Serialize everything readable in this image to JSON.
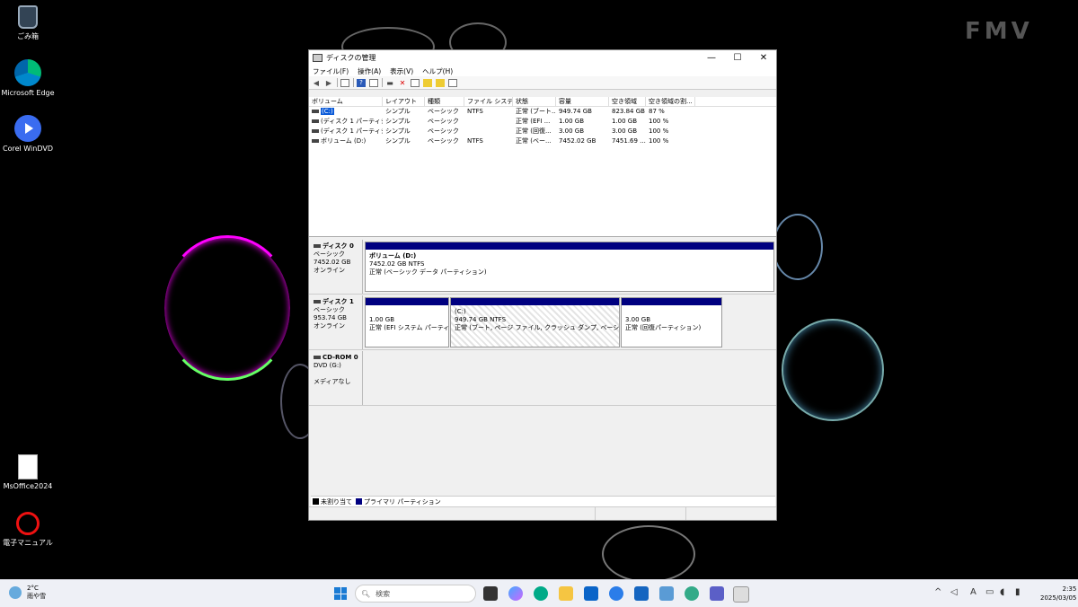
{
  "desktop": {
    "brand": "FMV",
    "icons": [
      {
        "label": "ごみ箱",
        "icon": "recycle-bin-icon"
      },
      {
        "label": "Microsoft Edge",
        "icon": "edge-icon"
      },
      {
        "label": "Corel WinDVD",
        "icon": "windvd-icon"
      },
      {
        "label": "MsOffice2024",
        "icon": "document-icon"
      },
      {
        "label": "電子マニュアル",
        "icon": "manual-icon"
      }
    ]
  },
  "window": {
    "title": "ディスクの管理",
    "controls": {
      "minimize": "—",
      "maximize": "☐",
      "close": "✕"
    },
    "menu": [
      "ファイル(F)",
      "操作(A)",
      "表示(V)",
      "ヘルプ(H)"
    ],
    "toolbar": [
      "back-icon",
      "forward-icon",
      "properties-icon",
      "help-icon",
      "view-icon",
      "connect-icon",
      "delete-icon",
      "check-icon",
      "new-icon",
      "open-icon",
      "list-icon"
    ],
    "volume_list": {
      "columns": [
        "ボリューム",
        "レイアウト",
        "種類",
        "ファイル システム",
        "状態",
        "容量",
        "空き領域",
        "空き領域の割..."
      ],
      "rows": [
        [
          "(C:)",
          "シンプル",
          "ベーシック",
          "NTFS",
          "正常 (ブート...",
          "949.74 GB",
          "823.84 GB",
          "87 %"
        ],
        [
          "(ディスク 1 パーティシ...",
          "シンプル",
          "ベーシック",
          "",
          "正常 (EFI ...",
          "1.00 GB",
          "1.00 GB",
          "100 %"
        ],
        [
          "(ディスク 1 パーティシ...",
          "シンプル",
          "ベーシック",
          "",
          "正常 (回復...",
          "3.00 GB",
          "3.00 GB",
          "100 %"
        ],
        [
          "ボリューム (D:)",
          "シンプル",
          "ベーシック",
          "NTFS",
          "正常 (ベー...",
          "7452.02 GB",
          "7451.69 ...",
          "100 %"
        ]
      ]
    },
    "disks": [
      {
        "name": "ディスク 0",
        "type": "ベーシック",
        "size": "7452.02 GB",
        "status": "オンライン",
        "partitions": [
          {
            "name": "ボリューム (D:)",
            "size": "7452.02 GB NTFS",
            "status": "正常 (ベーシック データ パーティション)"
          }
        ]
      },
      {
        "name": "ディスク 1",
        "type": "ベーシック",
        "size": "953.74 GB",
        "status": "オンライン",
        "partitions": [
          {
            "name": "",
            "size": "1.00 GB",
            "status": "正常 (EFI システム パーティション)"
          },
          {
            "name": "(C:)",
            "size": "949.74 GB NTFS",
            "status": "正常 (ブート, ページ ファイル, クラッシュ ダンプ, ベーシック データ パーティション)"
          },
          {
            "name": "",
            "size": "3.00 GB",
            "status": "正常 (回復パーティション)"
          }
        ]
      },
      {
        "name": "CD-ROM 0",
        "type": "DVD (G:)",
        "size": "",
        "status": "メディアなし",
        "partitions": []
      }
    ],
    "legend": [
      {
        "label": "未割り当て",
        "color": "#000000"
      },
      {
        "label": "プライマリ パーティション",
        "color": "#000080"
      }
    ]
  },
  "taskbar": {
    "weather_temp": "2°C",
    "weather_desc": "雨や雪",
    "search_placeholder": "検索",
    "apps": [
      "task-view-icon",
      "copilot-icon",
      "edge-icon",
      "explorer-icon",
      "outlook-icon",
      "mail-icon",
      "store-icon",
      "photos-icon",
      "maps-icon",
      "teams-icon",
      "disk-management-icon"
    ],
    "tray": [
      "chevron-up-icon",
      "pen-icon",
      "ime-icon",
      "display-icon",
      "volume-icon",
      "battery-icon"
    ],
    "ime": "A",
    "time": "2:35",
    "date": "2025/03/05"
  },
  "colors": {
    "primary_partition": "#000080",
    "selection": "#0a5ad8",
    "start": "#1a7bd4"
  }
}
